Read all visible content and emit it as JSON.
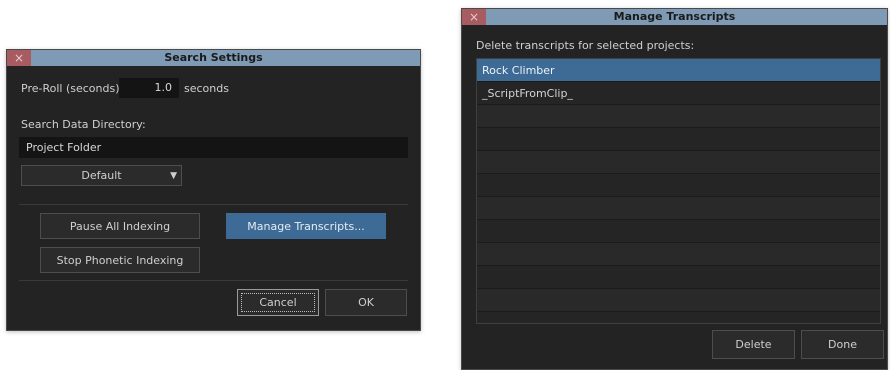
{
  "search_settings": {
    "title": "Search Settings",
    "close_icon": "×",
    "preroll_label": "Pre-Roll (seconds):",
    "preroll_value": "1.0",
    "preroll_unit": "seconds",
    "directory_label": "Search Data Directory:",
    "directory_value": "Project Folder",
    "dropdown_value": "Default",
    "dropdown_caret": "▼",
    "pause_indexing_label": "Pause All Indexing",
    "manage_transcripts_label": "Manage Transcripts...",
    "stop_phonetic_label": "Stop Phonetic Indexing",
    "cancel_label": "Cancel",
    "ok_label": "OK"
  },
  "manage_transcripts": {
    "title": "Manage Transcripts",
    "close_icon": "×",
    "instruction": "Delete transcripts for selected projects:",
    "items": [
      "Rock Climber",
      "_ScriptFromClip_",
      "",
      "",
      "",
      "",
      "",
      "",
      "",
      "",
      "",
      ""
    ],
    "selected_index": 0,
    "delete_label": "Delete",
    "done_label": "Done"
  },
  "colors": {
    "titlebar": "#7e9ab4",
    "close_button": "#a85c61",
    "dialog_bg": "#232323",
    "accent": "#3d6b96"
  }
}
